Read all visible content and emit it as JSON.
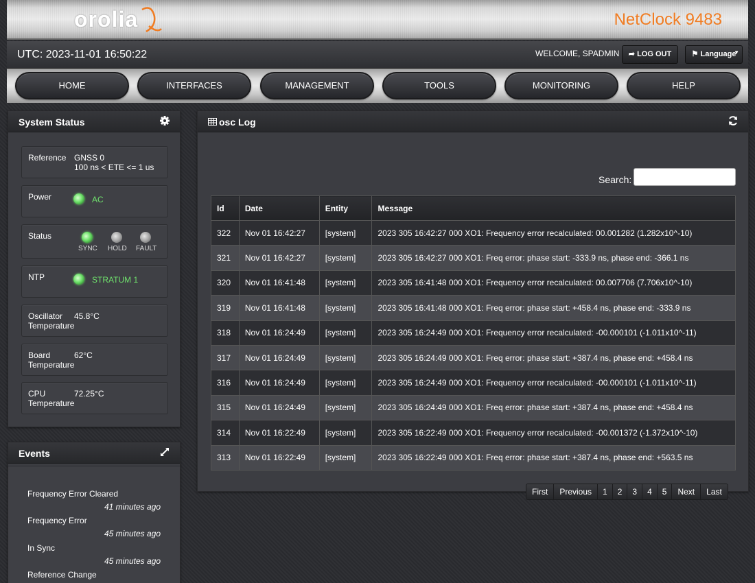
{
  "header": {
    "logo_text": "orolia",
    "product": "NetClock 9483"
  },
  "statusbar": {
    "utc": "UTC: 2023-11-01 16:50:22",
    "welcome": "WELCOME, SPADMIN",
    "logout_label": "LOG OUT",
    "language_label": "Language"
  },
  "nav": {
    "items": [
      "HOME",
      "INTERFACES",
      "MANAGEMENT",
      "TOOLS",
      "MONITORING",
      "HELP"
    ]
  },
  "system_status": {
    "title": "System Status",
    "reference": {
      "label": "Reference",
      "value1": "GNSS 0",
      "value2": "100 ns < ETE <= 1 us"
    },
    "power": {
      "label": "Power",
      "value": "AC"
    },
    "status": {
      "label": "Status",
      "sync": "SYNC",
      "hold": "HOLD",
      "fault": "FAULT"
    },
    "ntp": {
      "label": "NTP",
      "value": "STRATUM 1"
    },
    "oscillator": {
      "label1": "Oscillator",
      "label2": "Temperature",
      "value": "45.8°C"
    },
    "board": {
      "label1": "Board",
      "label2": "Temperature",
      "value": "62°C"
    },
    "cpu": {
      "label1": "CPU",
      "label2": "Temperature",
      "value": "72.25°C"
    }
  },
  "events": {
    "title": "Events",
    "items": [
      {
        "title": "Frequency Error Cleared",
        "time": "41 minutes ago"
      },
      {
        "title": "Frequency Error",
        "time": "45 minutes ago"
      },
      {
        "title": "In Sync",
        "time": "45 minutes ago"
      },
      {
        "title": "Reference Change",
        "time": ""
      }
    ]
  },
  "log": {
    "title": "osc Log",
    "search_label": "Search:",
    "search_value": "",
    "columns": [
      "Id",
      "Date",
      "Entity",
      "Message"
    ],
    "rows": [
      {
        "id": "322",
        "date": "Nov 01 16:42:27",
        "entity": "[system]",
        "message": "2023 305 16:42:27 000 XO1: Frequency error recalculated: 00.001282 (1.282x10^-10)"
      },
      {
        "id": "321",
        "date": "Nov 01 16:42:27",
        "entity": "[system]",
        "message": "2023 305 16:42:27 000 XO1: Freq error: phase start: -333.9 ns, phase end: -366.1 ns"
      },
      {
        "id": "320",
        "date": "Nov 01 16:41:48",
        "entity": "[system]",
        "message": "2023 305 16:41:48 000 XO1: Frequency error recalculated: 00.007706 (7.706x10^-10)"
      },
      {
        "id": "319",
        "date": "Nov 01 16:41:48",
        "entity": "[system]",
        "message": "2023 305 16:41:48 000 XO1: Freq error: phase start: +458.4 ns, phase end: -333.9 ns"
      },
      {
        "id": "318",
        "date": "Nov 01 16:24:49",
        "entity": "[system]",
        "message": "2023 305 16:24:49 000 XO1: Frequency error recalculated: -00.000101 (-1.011x10^-11)"
      },
      {
        "id": "317",
        "date": "Nov 01 16:24:49",
        "entity": "[system]",
        "message": "2023 305 16:24:49 000 XO1: Freq error: phase start: +387.4 ns, phase end: +458.4 ns"
      },
      {
        "id": "316",
        "date": "Nov 01 16:24:49",
        "entity": "[system]",
        "message": "2023 305 16:24:49 000 XO1: Frequency error recalculated: -00.000101 (-1.011x10^-11)"
      },
      {
        "id": "315",
        "date": "Nov 01 16:24:49",
        "entity": "[system]",
        "message": "2023 305 16:24:49 000 XO1: Freq error: phase start: +387.4 ns, phase end: +458.4 ns"
      },
      {
        "id": "314",
        "date": "Nov 01 16:22:49",
        "entity": "[system]",
        "message": "2023 305 16:22:49 000 XO1: Frequency error recalculated: -00.001372 (-1.372x10^-10)"
      },
      {
        "id": "313",
        "date": "Nov 01 16:22:49",
        "entity": "[system]",
        "message": "2023 305 16:22:49 000 XO1: Freq error: phase start: +387.4 ns, phase end: +563.5 ns"
      }
    ],
    "pagination": {
      "first": "First",
      "previous": "Previous",
      "pages": [
        "1",
        "2",
        "3",
        "4",
        "5"
      ],
      "next": "Next",
      "last": "Last",
      "current": "1"
    }
  },
  "icons": {
    "gear": "gear-icon",
    "expand": "expand-icon",
    "table": "table-icon",
    "refresh": "refresh-icon",
    "logout": "logout-icon",
    "flag": "flag-icon"
  },
  "colors": {
    "accent": "#f07c22",
    "ok_green": "#6fe06c"
  }
}
